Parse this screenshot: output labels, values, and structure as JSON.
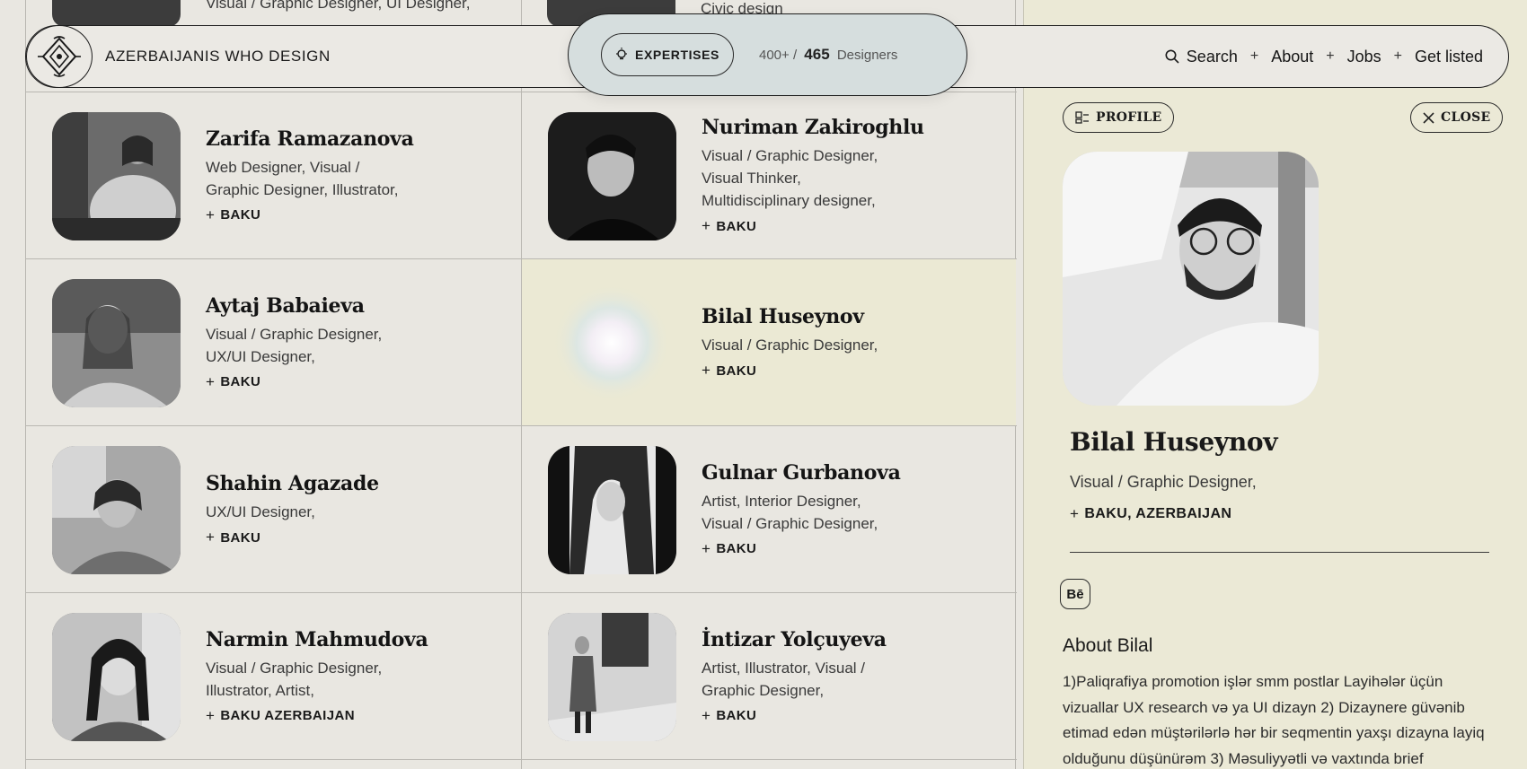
{
  "header": {
    "brand": "AZERBAIJANIS WHO DESIGN",
    "logo_icon": "ornament-logo-icon",
    "expertises_label": "EXPERTISES",
    "count_total": "400+ /",
    "count_current": "465",
    "count_suffix": "Designers",
    "nav": {
      "search": "Search",
      "about": "About",
      "jobs": "Jobs",
      "get_listed": "Get listed"
    },
    "nav_separator": "+"
  },
  "partial_row": {
    "left_text": "Visual / Graphic Designer, UI Designer,",
    "right_text": "Civic design"
  },
  "designers": [
    {
      "name": "Zarifa Ramazanova",
      "roles": [
        "Web Designer, Visual /",
        "Graphic Designer, Illustrator,"
      ],
      "city": "BAKU"
    },
    {
      "name": "Nuriman Zakiroghlu",
      "roles": [
        "Visual / Graphic Designer,",
        "Visual Thinker,",
        "Multidisciplinary designer,"
      ],
      "city": "BAKU"
    },
    {
      "name": "Aytaj Babaieva",
      "roles": [
        "Visual / Graphic Designer,",
        "UX/UI Designer,"
      ],
      "city": "BAKU"
    },
    {
      "name": "Bilal Huseynov",
      "roles": [
        "Visual / Graphic Designer,"
      ],
      "city": "BAKU"
    },
    {
      "name": "Shahin Agazade",
      "roles": [
        "UX/UI Designer,"
      ],
      "city": "BAKU"
    },
    {
      "name": "Gulnar Gurbanova",
      "roles": [
        "Artist, Interior Designer,",
        "Visual / Graphic Designer,"
      ],
      "city": "BAKU"
    },
    {
      "name": "Narmin Mahmudova",
      "roles": [
        "Visual / Graphic Designer,",
        "Illustrator, Artist,"
      ],
      "city": "BAKU AZERBAIJAN"
    },
    {
      "name": "İntizar Yolçuyeva",
      "roles": [
        "Artist, Illustrator, Visual /",
        "Graphic Designer,"
      ],
      "city": "BAKU"
    }
  ],
  "profile": {
    "profile_label": "PROFILE",
    "close_label": "CLOSE",
    "name": "Bilal Huseynov",
    "roles": "Visual / Graphic Designer,",
    "location": "BAKU, AZERBAIJAN",
    "behance_label": "Bē",
    "about_heading": "About Bilal",
    "about_text": "1)Paliqrafiya promotion işlər smm postlar Layihələr üçün vizuallar UX research və ya UI dizayn 2) Dizaynere güvənib etimad edən müştərilərlə hər bir seqmentin yaxşı dizayna layiq olduğunu düşünürəm 3) Məsuliyyətli və vaxtında brief"
  },
  "colors": {
    "background": "#e9e7e1",
    "highlight": "#ebe9d4",
    "pill": "#d6dede",
    "ink": "#1a1a1a"
  }
}
